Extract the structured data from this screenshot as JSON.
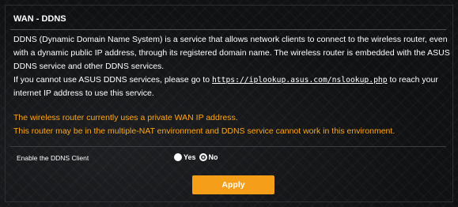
{
  "section": {
    "title": "WAN - DDNS",
    "description": {
      "line1": "DDNS (Dynamic Domain Name System) is a service that allows network clients to connect to the wireless router, even with a dynamic public IP address, through its registered domain name. The wireless router is embedded with the ASUS DDNS service and other DDNS services.",
      "line2_before": "If you cannot use ASUS DDNS services, please go to ",
      "line2_link": "https://iplookup.asus.com/nslookup.php",
      "line2_after": " to reach your internet IP address to use this service."
    },
    "warnings": [
      "The wireless router currently uses a private WAN IP address.",
      "This router may be in the multiple-NAT environment and DDNS service cannot work in this environment."
    ]
  },
  "setting": {
    "label": "Enable the DDNS Client",
    "options": [
      {
        "label": "Yes",
        "selected": true
      },
      {
        "label": "No",
        "selected": false
      }
    ]
  },
  "apply_button": {
    "label": "Apply"
  },
  "colors": {
    "warning": "#ffa715",
    "apply_button": "#f49e1a",
    "background": "#101113"
  }
}
